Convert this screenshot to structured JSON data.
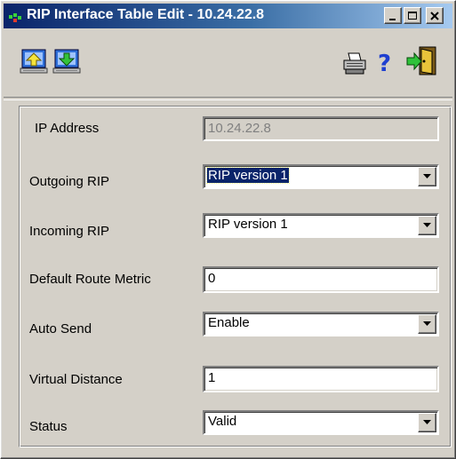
{
  "window": {
    "title": "RIP Interface Table Edit - 10.24.22.8",
    "title_buttons": [
      "minimize-icon",
      "maximize-icon",
      "close-icon"
    ]
  },
  "toolbar": {
    "left_icons": [
      "upload-icon",
      "download-icon"
    ],
    "right_icons": [
      "printer-icon",
      "help-icon",
      "exit-icon"
    ]
  },
  "form": {
    "ip_address": {
      "label": "IP Address",
      "value": "10.24.22.8"
    },
    "outgoing_rip": {
      "label": "Outgoing RIP",
      "value": "RIP version 1"
    },
    "incoming_rip": {
      "label": "Incoming RIP",
      "value": "RIP version 1"
    },
    "default_route_metric": {
      "label": "Default Route Metric",
      "value": "0"
    },
    "auto_send": {
      "label": "Auto Send",
      "value": "Enable"
    },
    "virtual_distance": {
      "label": "Virtual Distance",
      "value": "1"
    },
    "status": {
      "label": "Status",
      "value": "Valid"
    }
  },
  "colors": {
    "titlebar_start": "#0a246a",
    "titlebar_end": "#a6caf0",
    "face": "#d4d0c8",
    "selection": "#0a246a"
  }
}
